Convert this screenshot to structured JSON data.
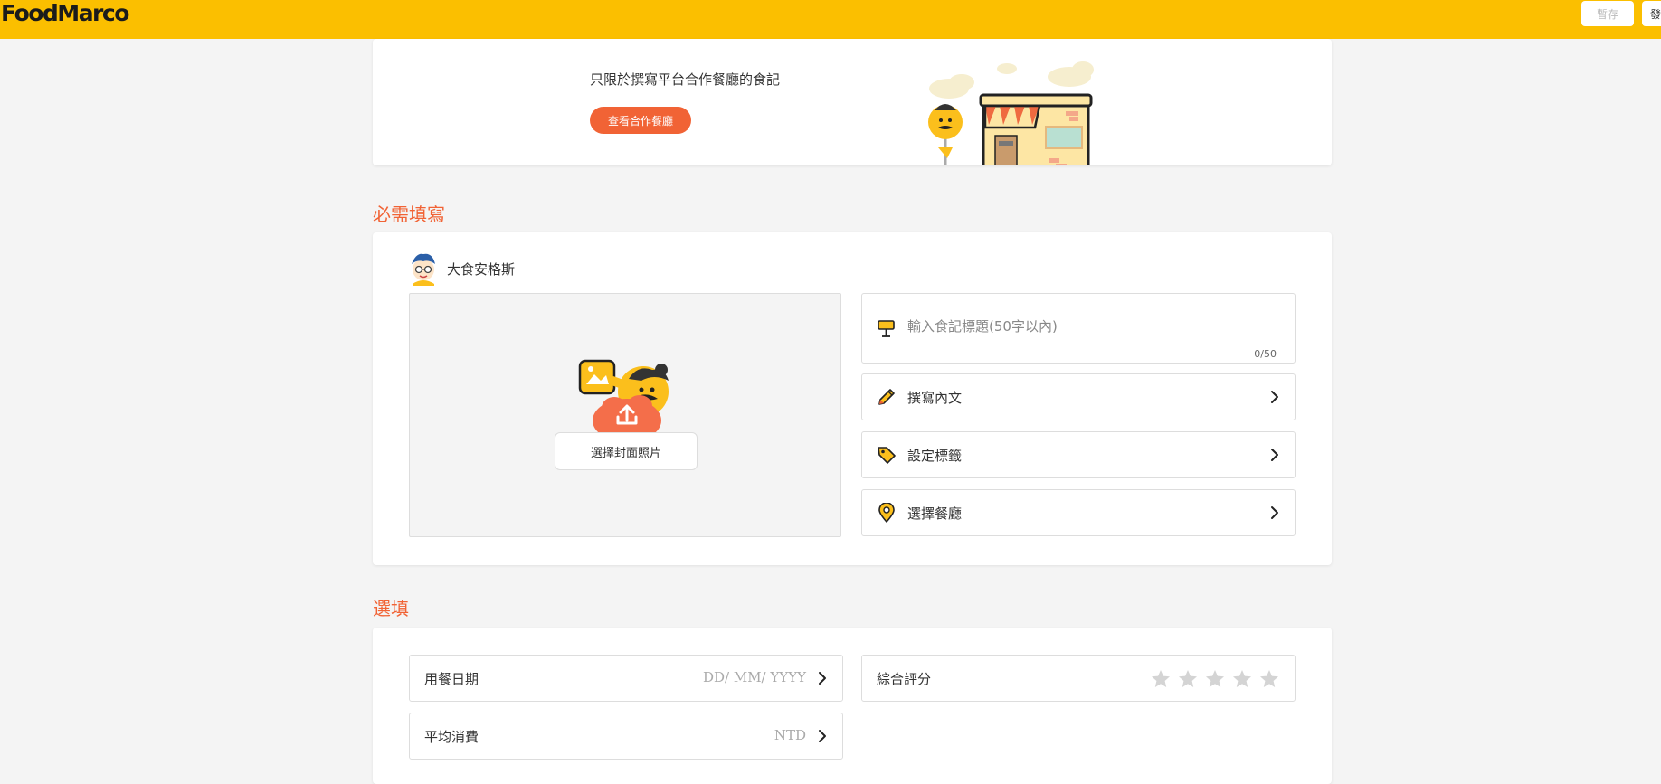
{
  "header": {
    "logo": "FoodMarco",
    "draft_label": "暫存",
    "publish_label": "發",
    "brand_color": "#fbbf00"
  },
  "banner": {
    "text": "只限於撰寫平台合作餐廳的食記",
    "button_label": "查看合作餐廳"
  },
  "required": {
    "section_title": "必需填寫",
    "author_name": "大食安格斯",
    "cover_button_label": "選擇封面照片",
    "title_placeholder": "輸入食記標題(50字以內)",
    "title_counter": "0/50",
    "rows": [
      {
        "label": "撰寫內文",
        "icon": "pencil-icon"
      },
      {
        "label": "設定標籤",
        "icon": "tag-icon"
      },
      {
        "label": "選擇餐廳",
        "icon": "location-pin-icon"
      }
    ]
  },
  "optional": {
    "section_title": "選填",
    "date_label": "用餐日期",
    "date_placeholder": "DD/ MM/ YYYY",
    "rating_label": "綜合評分",
    "rating_value": 0,
    "rating_max": 5,
    "cost_label": "平均消費",
    "cost_unit": "NTD"
  },
  "accent_color": "#f16335"
}
